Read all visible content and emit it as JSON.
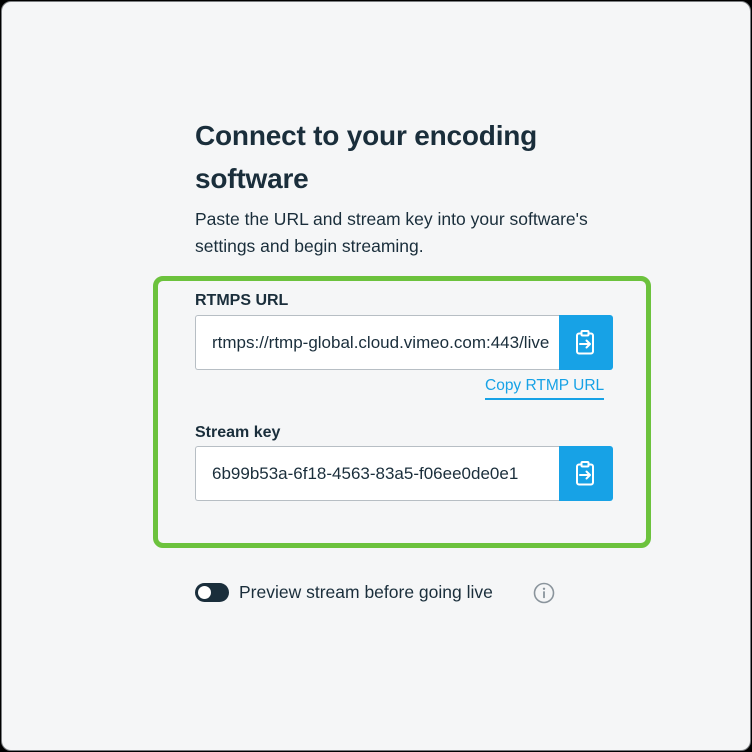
{
  "dialog": {
    "title": "Connect to your encoding software",
    "subtitle": "Paste the URL and stream key into your software's settings and begin streaming."
  },
  "rtmps": {
    "label": "RTMPS URL",
    "value": "rtmps://rtmp-global.cloud.vimeo.com:443/live",
    "copy_icon": "clipboard-copy-icon",
    "alt_link": "Copy RTMP URL"
  },
  "stream_key": {
    "label": "Stream key",
    "value": "6b99b53a-6f18-4563-83a5-f06ee0de0e1",
    "copy_icon": "clipboard-copy-icon"
  },
  "preview": {
    "label": "Preview stream before going live",
    "toggle_on": false,
    "info_icon": "info-circle-icon"
  },
  "colors": {
    "accent": "#17a2e6",
    "highlight": "#6cc23d",
    "text": "#1a2e3b"
  }
}
